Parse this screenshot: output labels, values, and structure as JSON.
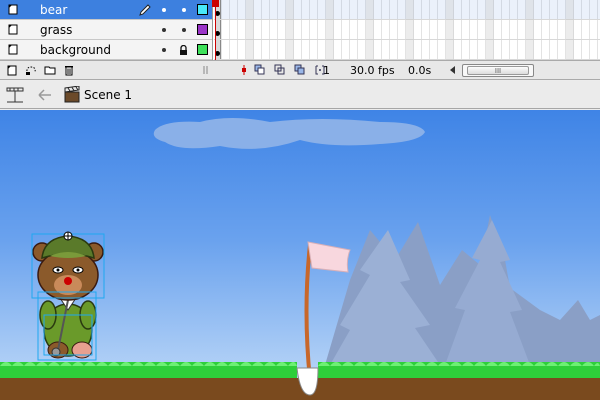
{
  "layers": [
    {
      "name": "bear",
      "selected": true,
      "color": "#48e8f8"
    },
    {
      "name": "grass",
      "selected": false,
      "color": "#9b35c8"
    },
    {
      "name": "background",
      "selected": false,
      "color": "#3ee05a",
      "locked": true
    }
  ],
  "timeline": {
    "current_frame": "1",
    "frame_rate": "30.0 fps",
    "elapsed_time": "0.0s",
    "scroll_thumb_grip": "III"
  },
  "editbar": {
    "scene_label": "Scene 1"
  },
  "colors": {
    "sky_top": "#3f84e6",
    "sky_bottom": "#c3dcf8",
    "grass": "#2ecf3a",
    "dirt": "#7a4a1e",
    "tree": "#8a9fc6",
    "flag": "#f8d7de",
    "pole": "#c8672a",
    "selection": "#1fa8f0"
  },
  "icons": {
    "layer": "layer-icon",
    "edit": "pencil-icon",
    "lock": "lock-icon",
    "new_layer": "new-layer-icon",
    "motion_guide": "motion-guide-icon",
    "folder": "folder-icon",
    "delete": "trash-icon",
    "scene": "clapperboard-icon",
    "back": "back-arrow-icon",
    "timeline_toggle": "timeline-toggle-icon"
  }
}
